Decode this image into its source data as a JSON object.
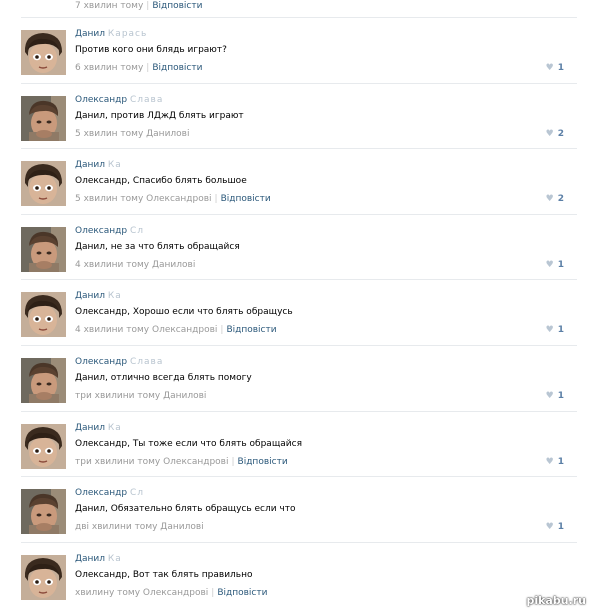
{
  "top_partial": {
    "time": "7 хвилин тому",
    "reply": "Відповісти"
  },
  "comments": [
    {
      "name": "Данил",
      "name_blur": "Карась",
      "text": "Против кого они блядь играют?",
      "time": "6 хвилин тому",
      "reply": "Відповісти",
      "likes": "1",
      "avatar": "danil"
    },
    {
      "name": "Олександр",
      "name_blur": "Слава",
      "text": "Данил, против ЛДжД блять играют",
      "time": "5 хвилин тому Данилові",
      "reply": "",
      "likes": "2",
      "avatar": "oleksandr"
    },
    {
      "name": "Данил",
      "name_blur": "Ка",
      "text": "Олександр, Спасибо блять большое",
      "time": "5 хвилин тому Олександрові",
      "reply": "Відповісти",
      "likes": "2",
      "avatar": "danil"
    },
    {
      "name": "Олександр",
      "name_blur": "Сл",
      "text": "Данил, не за что блять обращайся",
      "time": "4 хвилини тому Данилові",
      "reply": "",
      "likes": "1",
      "avatar": "oleksandr"
    },
    {
      "name": "Данил",
      "name_blur": "Ка",
      "text": "Олександр, Хорошо если что блять обращусь",
      "time": "4 хвилини тому Олександрові",
      "reply": "Відповісти",
      "likes": "1",
      "avatar": "danil"
    },
    {
      "name": "Олександр",
      "name_blur": "Слава",
      "text": "Данил, отлично всегда блять помогу",
      "time": "три хвилини тому Данилові",
      "reply": "",
      "likes": "1",
      "avatar": "oleksandr"
    },
    {
      "name": "Данил",
      "name_blur": "Ка",
      "text": "Олександр, Ты тоже если что блять обращайся",
      "time": "три хвилини тому Олександрові",
      "reply": "Відповісти",
      "likes": "1",
      "avatar": "danil"
    },
    {
      "name": "Олександр",
      "name_blur": "Сл",
      "text": "Данил, Обязательно блять обращусь если что",
      "time": "дві хвилини тому Данилові",
      "reply": "",
      "likes": "1",
      "avatar": "oleksandr"
    },
    {
      "name": "Данил",
      "name_blur": "Ка",
      "text": "Олександр, Вот так блять правильно",
      "time": "хвилину тому Олександрові",
      "reply": "Відповісти",
      "likes": "",
      "avatar": "danil"
    }
  ],
  "watermark": "pikabu.ru",
  "colors": {
    "link": "#2b587a",
    "meta": "#999999",
    "like_count": "#5b7fa6",
    "heart": "#b9c6d3",
    "divider": "#e7eaed"
  }
}
